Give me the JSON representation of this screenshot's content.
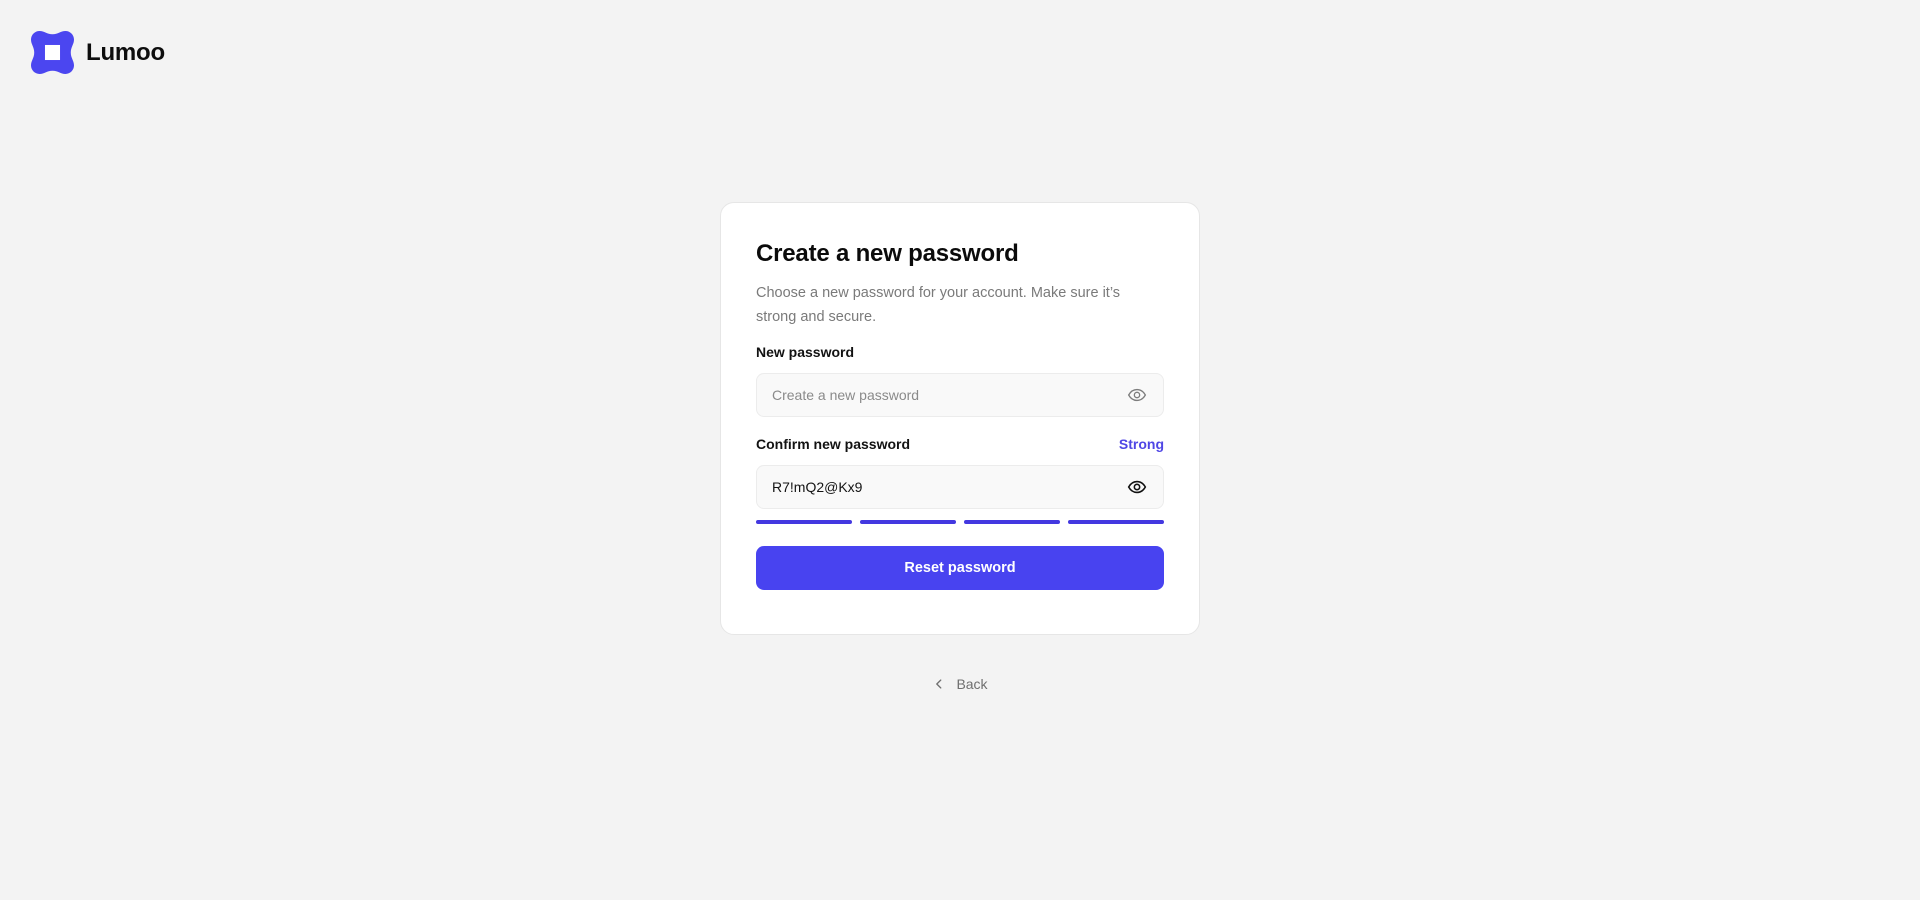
{
  "brand": {
    "name": "Lumoo",
    "logo_icon": "lumoo-logo-icon",
    "accent_color": "#4f46e5"
  },
  "card": {
    "title": "Create a new password",
    "subtitle": "Choose a new password for your account. Make sure it’s strong and secure.",
    "new_password": {
      "label": "New password",
      "placeholder": "Create a new password",
      "value": "",
      "toggle_icon": "eye-icon"
    },
    "confirm_password": {
      "label": "Confirm new password",
      "strength_label": "Strong",
      "value": "R7!mQ2@Kx9",
      "toggle_icon": "eye-icon"
    },
    "strength_meter": {
      "filled_segments": 4,
      "total_segments": 4,
      "color": "#4338e0"
    },
    "submit_label": "Reset password",
    "submit_color": "#4843f0"
  },
  "back": {
    "label": "Back",
    "icon": "chevron-left-icon"
  }
}
